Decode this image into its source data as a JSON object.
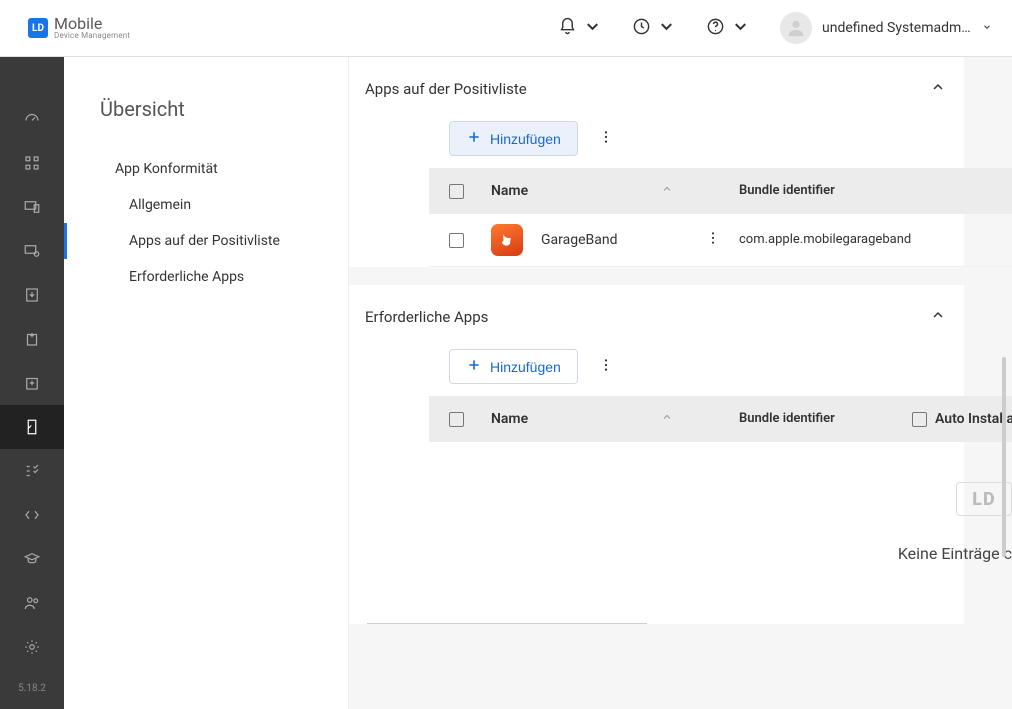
{
  "header": {
    "logo_badge": "LD",
    "logo_main": "Mobile",
    "logo_sub": "Device Management",
    "user_name": "undefined Systemadmi..."
  },
  "rail": {
    "version": "5.18.2"
  },
  "sidebar": {
    "title": "Übersicht",
    "items": [
      {
        "label": "App Konformität",
        "level": 1,
        "selected": false
      },
      {
        "label": "Allgemein",
        "level": 2,
        "selected": false
      },
      {
        "label": "Apps auf der Positivliste",
        "level": 2,
        "selected": true
      },
      {
        "label": "Erforderliche Apps",
        "level": 2,
        "selected": false
      }
    ]
  },
  "sections": {
    "allowlist": {
      "title": "Apps auf der Positivliste",
      "add_label": "Hinzufügen",
      "columns": {
        "name": "Name",
        "bundle": "Bundle identifier"
      },
      "rows": [
        {
          "name": "GarageBand",
          "bundle": "com.apple.mobilegarageband"
        }
      ]
    },
    "required": {
      "title": "Erforderliche Apps",
      "add_label": "Hinzufügen",
      "columns": {
        "name": "Name",
        "bundle": "Bundle identifier",
        "auto": "Auto Installat"
      },
      "empty_badge": "LD",
      "empty_text": "Keine Einträge c"
    }
  }
}
